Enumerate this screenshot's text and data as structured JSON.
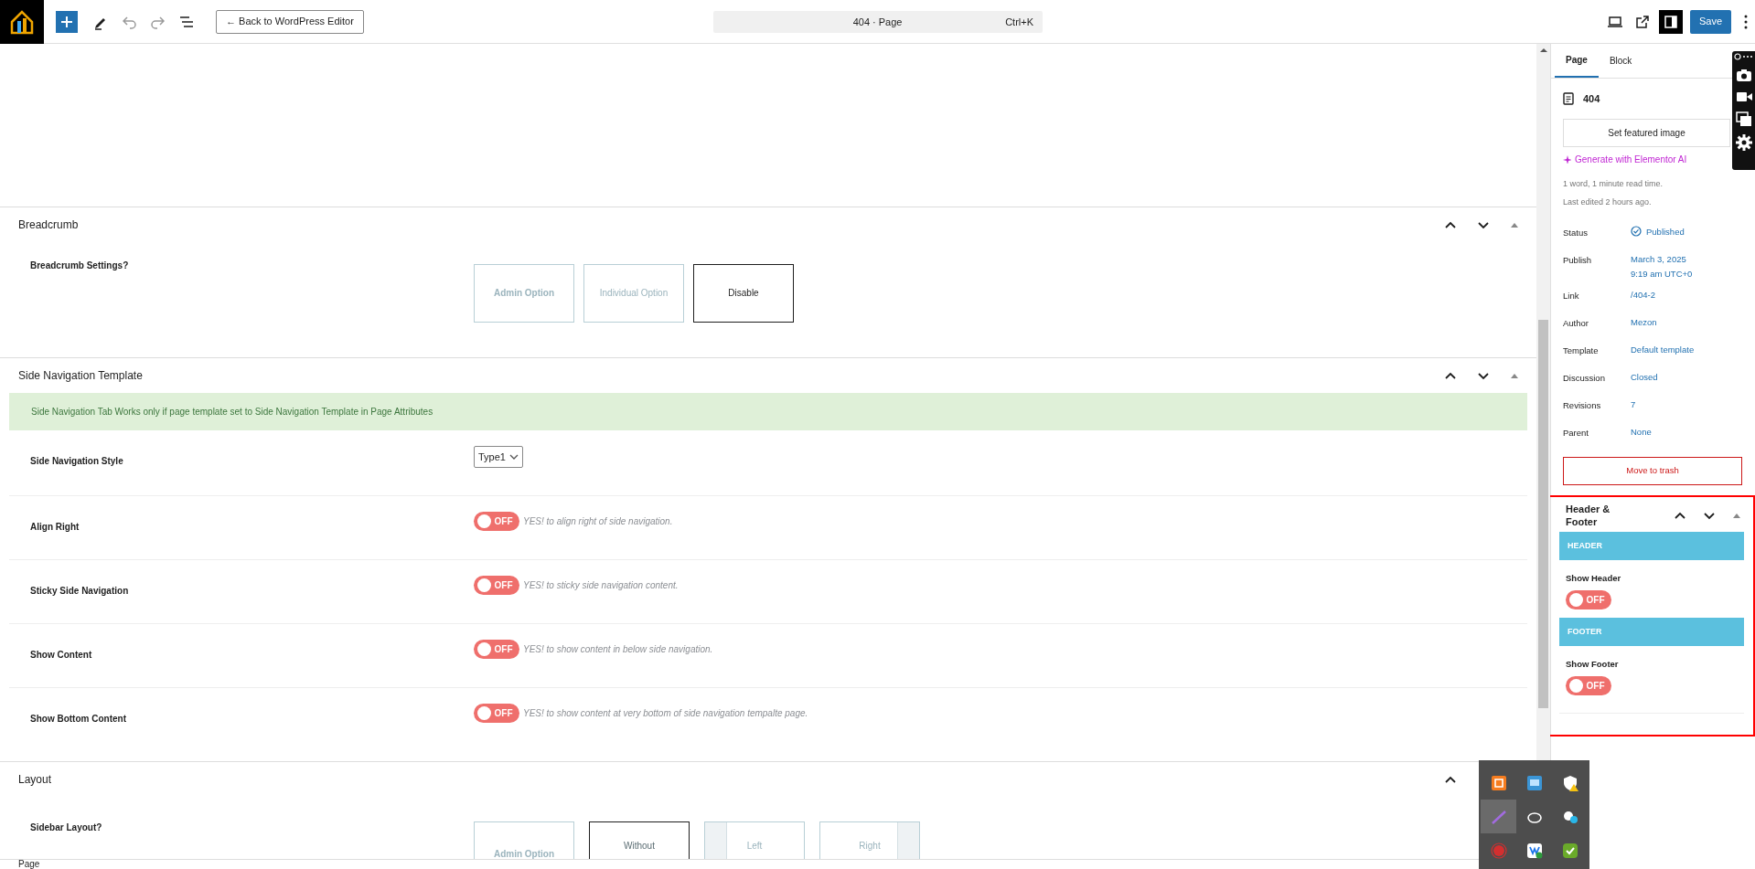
{
  "toolbar": {
    "back_button": "← Back to WordPress Editor",
    "command": {
      "title": "404 · Page",
      "shortcut": "Ctrl+K"
    },
    "save": "Save"
  },
  "sections": [
    {
      "title": "Breadcrumb",
      "controls": [
        {
          "kind": "up"
        },
        {
          "kind": "down"
        },
        {
          "kind": "collapse"
        }
      ],
      "rows": [
        {
          "kind": "choice",
          "label": "Breadcrumb Settings?",
          "options": [
            {
              "label": "Admin Option",
              "bold": true,
              "selected": false
            },
            {
              "label": "Individual Option",
              "bold": false,
              "selected": false
            },
            {
              "label": "Disable",
              "bold": false,
              "selected": true
            }
          ]
        }
      ]
    },
    {
      "title": "Side Navigation Template",
      "controls": [
        {
          "kind": "up"
        },
        {
          "kind": "down"
        },
        {
          "kind": "collapse"
        }
      ],
      "notice": "Side Navigation Tab Works only if page template set to Side Navigation Template in Page Attributes",
      "rows": [
        {
          "kind": "select",
          "label": "Side Navigation Style",
          "value": "Type1"
        },
        {
          "kind": "toggle",
          "label": "Align Right",
          "on": false,
          "state_text": "OFF",
          "hint": "YES! to align right of side navigation."
        },
        {
          "kind": "toggle",
          "label": "Sticky Side Navigation",
          "on": false,
          "state_text": "OFF",
          "hint": "YES! to sticky side navigation content."
        },
        {
          "kind": "toggle",
          "label": "Show Content",
          "on": false,
          "state_text": "OFF",
          "hint": "YES! to show content in below side navigation."
        },
        {
          "kind": "toggle",
          "label": "Show Bottom Content",
          "on": false,
          "state_text": "OFF",
          "hint": "YES! to show content at very bottom of side navigation tempalte page."
        }
      ]
    },
    {
      "title": "Layout",
      "controls": [
        {
          "kind": "up"
        }
      ],
      "rows": [
        {
          "kind": "layout",
          "label": "Sidebar Layout?",
          "options": [
            {
              "label": "Admin Option",
              "kind": "plain",
              "bold": true,
              "selected": false
            },
            {
              "label": "Without",
              "kind": "plain",
              "bold": false,
              "selected": true
            },
            {
              "label": "Left",
              "kind": "left",
              "bold": false,
              "selected": false
            },
            {
              "label": "Right",
              "kind": "right",
              "bold": false,
              "selected": false
            }
          ]
        }
      ]
    }
  ],
  "status_bar": "Page",
  "sidebar": {
    "tabs": [
      {
        "label": "Page",
        "selected": true
      },
      {
        "label": "Block",
        "selected": false
      }
    ],
    "page_title": "404",
    "featured_button": "Set featured image",
    "ai_link": "Generate with Elementor AI",
    "stats": [
      "1 word, 1 minute read time.",
      "Last edited 2 hours ago."
    ],
    "fields": [
      {
        "label": "Status",
        "kind": "status",
        "lines": [
          "Published"
        ]
      },
      {
        "label": "Publish",
        "kind": "link",
        "lines": [
          "March 3, 2025",
          "9:19 am UTC+0"
        ]
      },
      {
        "label": "Link",
        "kind": "link",
        "lines": [
          "/404-2"
        ]
      },
      {
        "label": "Author",
        "kind": "link",
        "lines": [
          "Mezon"
        ]
      },
      {
        "label": "Template",
        "kind": "link",
        "lines": [
          "Default template"
        ]
      },
      {
        "label": "Discussion",
        "kind": "link",
        "lines": [
          "Closed"
        ]
      },
      {
        "label": "Revisions",
        "kind": "link",
        "lines": [
          "7"
        ]
      },
      {
        "label": "Parent",
        "kind": "link",
        "lines": [
          "None"
        ]
      }
    ],
    "trash": "Move to trash",
    "panel": {
      "title": "Header & Footer",
      "groups": [
        {
          "heading": "HEADER",
          "label": "Show Header",
          "on": false,
          "state_text": "OFF"
        },
        {
          "heading": "FOOTER",
          "label": "Show Footer",
          "on": false,
          "state_text": "OFF"
        }
      ]
    }
  }
}
